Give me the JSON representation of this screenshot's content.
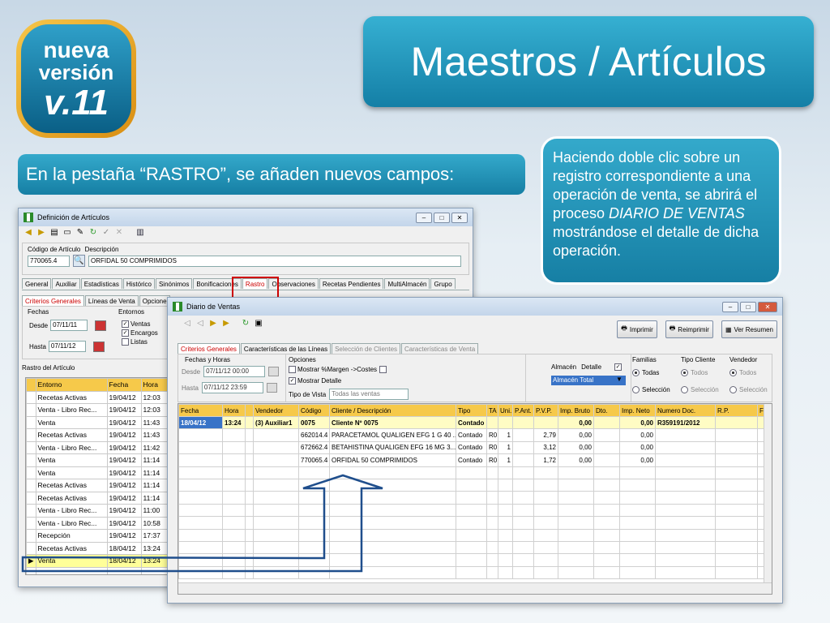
{
  "badge": {
    "line1": "nueva",
    "line2": "versión",
    "line3": "v.11"
  },
  "title": "Maestros / Artículos",
  "subtitle": "En la pestaña “RASTRO”, se añaden nuevos campos:",
  "callout": {
    "part1": "Haciendo doble clic sobre un registro correspondiente a una operación de venta, se abrirá el proceso ",
    "part2": "DIARIO DE VENTAS",
    "part3": " mostrándose el detalle de dicha operación."
  },
  "articulos_window": {
    "title": "Definición de Artículos",
    "codigo_label": "Código de Artículo",
    "descripcion_label": "Descripción",
    "codigo_value": "770065.4",
    "descripcion_value": "ORFIDAL 50 COMPRIMIDOS",
    "tabs": [
      "General",
      "Auxiliar",
      "Estadísticas",
      "Histórico",
      "Sinónimos",
      "Bonificaciones",
      "Rastro",
      "Observaciones",
      "Recetas Pendientes",
      "MultiAlmacén",
      "Grupo"
    ],
    "subtabs": [
      "Criterios Generales",
      "Líneas de Venta",
      "Opcione"
    ],
    "fechas_label": "Fechas",
    "desde_label": "Desde",
    "desde_value": "07/11/11",
    "hasta_label": "Hasta",
    "hasta_value": "07/11/12",
    "entornos_label": "Entornos",
    "entornos": [
      {
        "label": "Ventas",
        "checked": true
      },
      {
        "label": "Encargos",
        "checked": true
      },
      {
        "label": "Listas",
        "checked": false
      }
    ],
    "rastro_label": "Rastro del Artículo",
    "rastro_columns": [
      "Entorno",
      "Fecha",
      "Hora"
    ],
    "rastro_rows": [
      [
        "Recetas Activas",
        "19/04/12",
        "12:03"
      ],
      [
        "Venta - Libro Rec...",
        "19/04/12",
        "12:03"
      ],
      [
        "Venta",
        "19/04/12",
        "11:43"
      ],
      [
        "Recetas Activas",
        "19/04/12",
        "11:43"
      ],
      [
        "Venta - Libro Rec...",
        "19/04/12",
        "11:42"
      ],
      [
        "Venta",
        "19/04/12",
        "11:14"
      ],
      [
        "Venta",
        "19/04/12",
        "11:14"
      ],
      [
        "Recetas Activas",
        "19/04/12",
        "11:14"
      ],
      [
        "Recetas Activas",
        "19/04/12",
        "11:14"
      ],
      [
        "Venta - Libro Rec...",
        "19/04/12",
        "11:00"
      ],
      [
        "Venta - Libro Rec...",
        "19/04/12",
        "10:58"
      ],
      [
        "Recepción",
        "19/04/12",
        "17:37"
      ],
      [
        "Recetas Activas",
        "18/04/12",
        "13:24"
      ],
      [
        "Venta",
        "18/04/12",
        "13:24"
      ]
    ]
  },
  "diario_window": {
    "title": "Diario de Ventas",
    "buttons": {
      "imprimir": "Imprimir",
      "reimprimir": "Reimprimir",
      "ver_resumen": "Ver Resumen"
    },
    "tabs": [
      "Criterios Generales",
      "Características de las Líneas",
      "Selección de Clientes",
      "Características de Venta"
    ],
    "fechas_horas_label": "Fechas y Horas",
    "desde_label": "Desde",
    "desde_value": "07/11/12 00:00",
    "hasta_label": "Hasta",
    "hasta_value": "07/11/12 23:59",
    "opciones_label": "Opciones",
    "mostrar_margen": "Mostrar %Margen ->Costes",
    "mostrar_detalle": "Mostrar Detalle",
    "tipo_vista_label": "Tipo de Vista",
    "tipo_vista_value": "Todas las ventas",
    "almacen_label": "Almacén",
    "detalle_label": "Detalle",
    "almacen_value": "Almacén Total",
    "familias_label": "Familias",
    "tipo_cliente_label": "Tipo Cliente",
    "vendedor_label": "Vendedor",
    "todas_label": "Todas",
    "todos_label": "Todos",
    "seleccion_label": "Selección",
    "columns": [
      "Fecha",
      "Hora",
      "",
      "Vendedor",
      "Código",
      "Cliente / Descripción",
      "Tipo",
      "TA",
      "Uni.",
      "P.Ant.",
      "P.V.P.",
      "Imp. Bruto",
      "Dto.",
      "Imp. Neto",
      "Numero Doc.",
      "R.P.",
      "F"
    ],
    "rows": [
      [
        "18/04/12",
        "13:24",
        "",
        "(3) Auxiliar1",
        "0075",
        "Cliente Nº 0075",
        "Contado",
        "",
        "",
        "",
        "",
        "0,00",
        "",
        "0,00",
        "R359191/2012",
        "",
        ""
      ],
      [
        "",
        "",
        "",
        "",
        "662014.4",
        "PARACETAMOL QUALIGEN EFG 1 G 40 ...",
        "Contado",
        "R0",
        "1",
        "",
        "2,79",
        "0,00",
        "",
        "0,00",
        "",
        "",
        ""
      ],
      [
        "",
        "",
        "",
        "",
        "672662.4",
        "BETAHISTINA QUALIGEN EFG 16 MG 3...",
        "Contado",
        "R0",
        "1",
        "",
        "3,12",
        "0,00",
        "",
        "0,00",
        "",
        "",
        ""
      ],
      [
        "",
        "",
        "",
        "",
        "770065.4",
        "ORFIDAL 50 COMPRIMIDOS",
        "Contado",
        "R0",
        "1",
        "",
        "1,72",
        "0,00",
        "",
        "0,00",
        "",
        "",
        ""
      ]
    ]
  },
  "colors": {
    "accent": "#1a8fba",
    "header_yellow": "#f6c94a",
    "selection_blue": "#3873c7",
    "highlight_red": "#d00000",
    "arrow_blue": "#1f4e8c"
  }
}
